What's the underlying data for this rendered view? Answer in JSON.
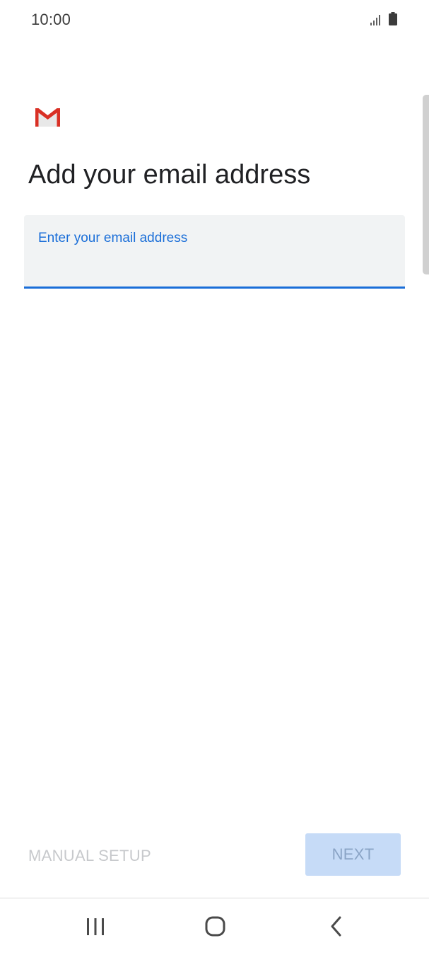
{
  "status_bar": {
    "time": "10:00",
    "icons": [
      "signal-icon",
      "battery-icon"
    ]
  },
  "app": {
    "logo_icon": "gmail-logo-icon",
    "brand_color": "#d93025"
  },
  "page": {
    "title": "Add your email address"
  },
  "email_field": {
    "label": "Enter your email address",
    "value": "",
    "accent_color": "#1a6ed8"
  },
  "actions": {
    "manual_setup_label": "MANUAL SETUP",
    "next_label": "NEXT",
    "next_disabled_color": "#c6dbf7"
  },
  "nav_bar": {
    "icons": [
      "recents-icon",
      "home-icon",
      "back-icon"
    ]
  }
}
